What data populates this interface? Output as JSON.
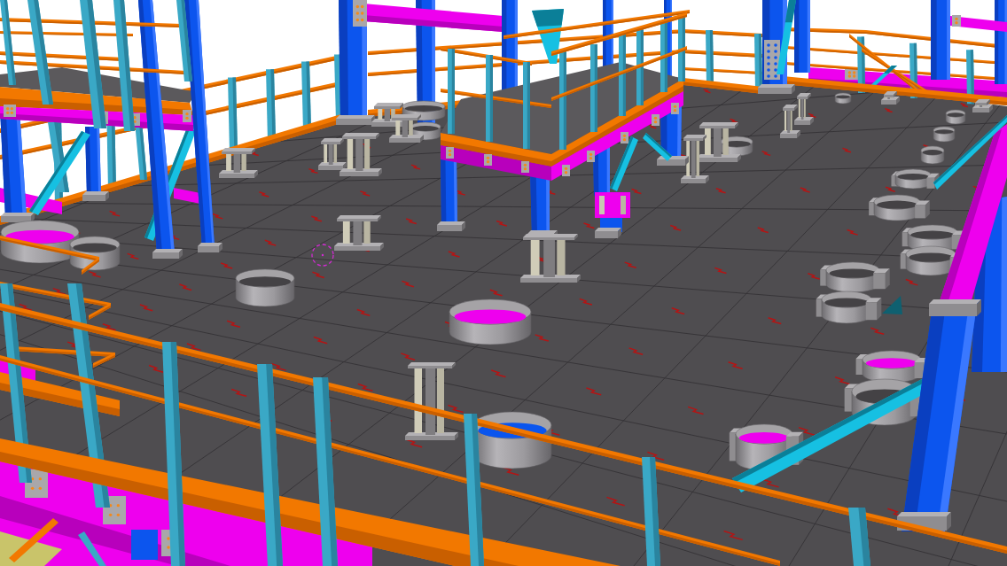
{
  "model_view": {
    "kind": "steel-structure"
  }
}
